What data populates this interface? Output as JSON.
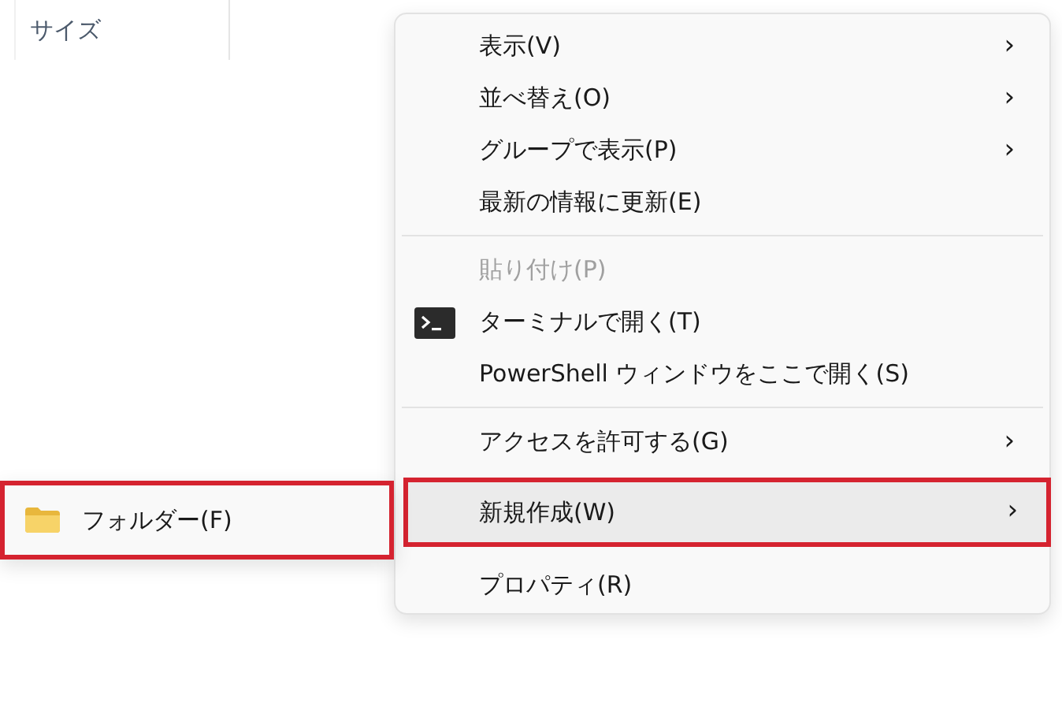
{
  "column_header": {
    "label": "サイズ"
  },
  "context_menu": {
    "items": [
      {
        "kind": "item",
        "label": "表示(V)",
        "arrow": "›",
        "disabled": false,
        "selected": false,
        "highlighted": false
      },
      {
        "kind": "item",
        "label": "並べ替え(O)",
        "arrow": "›",
        "disabled": false,
        "selected": false,
        "highlighted": false
      },
      {
        "kind": "item",
        "label": "グループで表示(P)",
        "arrow": "›",
        "disabled": false,
        "selected": false,
        "highlighted": false
      },
      {
        "kind": "item",
        "label": "最新の情報に更新(E)",
        "disabled": false,
        "selected": false,
        "highlighted": false
      },
      {
        "kind": "separator"
      },
      {
        "kind": "item",
        "label": "貼り付け(P)",
        "disabled": true,
        "selected": false,
        "highlighted": false
      },
      {
        "kind": "terminal-item",
        "label": "ターミナルで開く(T)",
        "disabled": false,
        "selected": false,
        "highlighted": false
      },
      {
        "kind": "item",
        "label": "PowerShell ウィンドウをここで開く(S)",
        "disabled": false,
        "selected": false,
        "highlighted": false
      },
      {
        "kind": "separator"
      },
      {
        "kind": "item",
        "label": "アクセスを許可する(G)",
        "arrow": "›",
        "disabled": false,
        "selected": false,
        "highlighted": false
      },
      {
        "kind": "item",
        "label": "新規作成(W)",
        "arrow": "›",
        "disabled": false,
        "selected": true,
        "highlighted": true
      },
      {
        "kind": "item",
        "label": "プロパティ(R)",
        "disabled": false,
        "selected": false,
        "highlighted": false
      }
    ]
  },
  "submenu": {
    "items": [
      {
        "kind": "folder-item",
        "label": "フォルダー(F)",
        "highlighted": true
      }
    ]
  }
}
